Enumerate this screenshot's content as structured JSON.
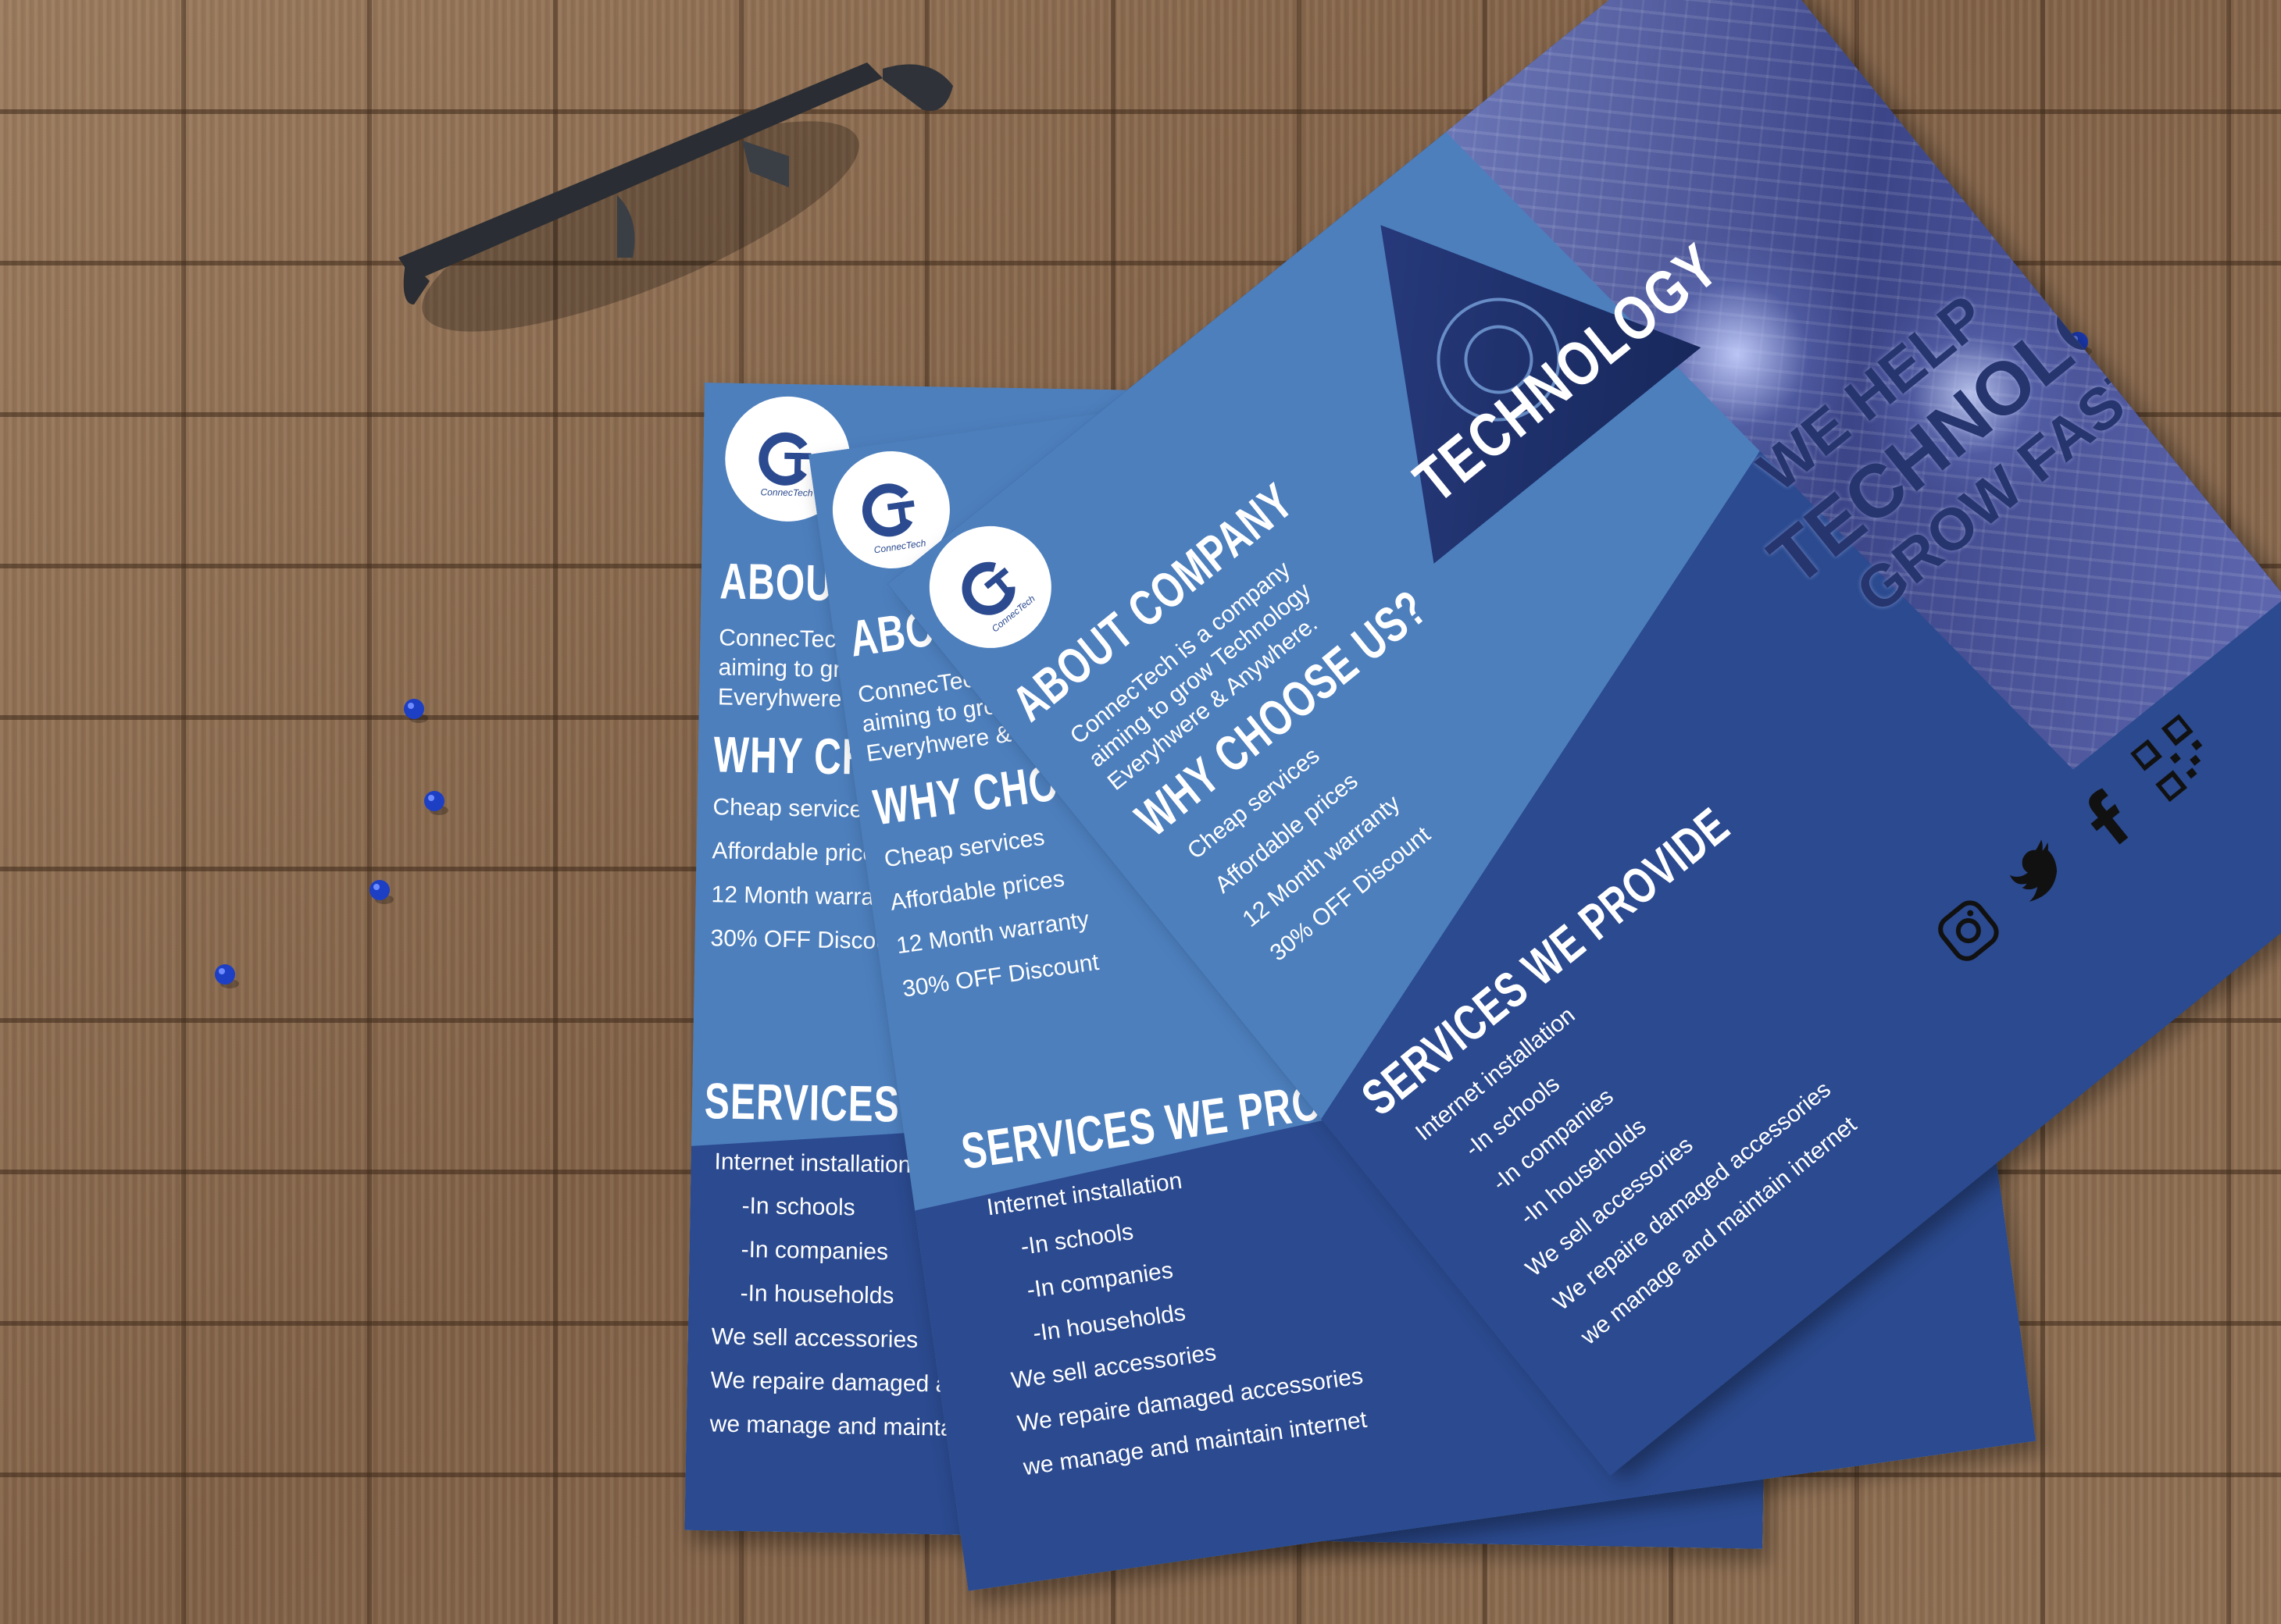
{
  "scene": {
    "background": "wooden parquet floor",
    "colors": {
      "wood": "#8a6a4f",
      "flyer_light": "#4d7fbd",
      "flyer_dark": "#2b4a8f",
      "pin": "#1d3fc4",
      "glasses": "#2a2d33"
    }
  },
  "flyer": {
    "logo_text": "ConnecTech",
    "about_heading": "ABOUT COMPANY",
    "about_body": [
      "ConnecTech is a company",
      "aiming to grow  Technology",
      "Everyhwere & Anywhere."
    ],
    "why_heading": "WHY CHOOSE US?",
    "why_items": [
      "Cheap services",
      "Affordable prices",
      "12 Month warranty",
      "30% OFF Discount"
    ],
    "services_heading": "SERVICES WE PROVIDE",
    "services_items": [
      {
        "text": "Internet installation",
        "indent": false
      },
      {
        "text": "-In schools",
        "indent": true
      },
      {
        "text": "-In companies",
        "indent": true
      },
      {
        "text": "-In households",
        "indent": true
      },
      {
        "text": "We sell accessories",
        "indent": false
      },
      {
        "text": "We repaire damaged accessories",
        "indent": false
      },
      {
        "text": "we manage and maintain internet",
        "indent": false
      }
    ],
    "badge_text": "TECHNOLOGY",
    "slogan": [
      "WE HELP",
      "TECHNOLOGY",
      "GROW FASTER"
    ],
    "social_icons": [
      "instagram-icon",
      "twitter-icon",
      "facebook-icon",
      "qr-code-icon"
    ]
  }
}
